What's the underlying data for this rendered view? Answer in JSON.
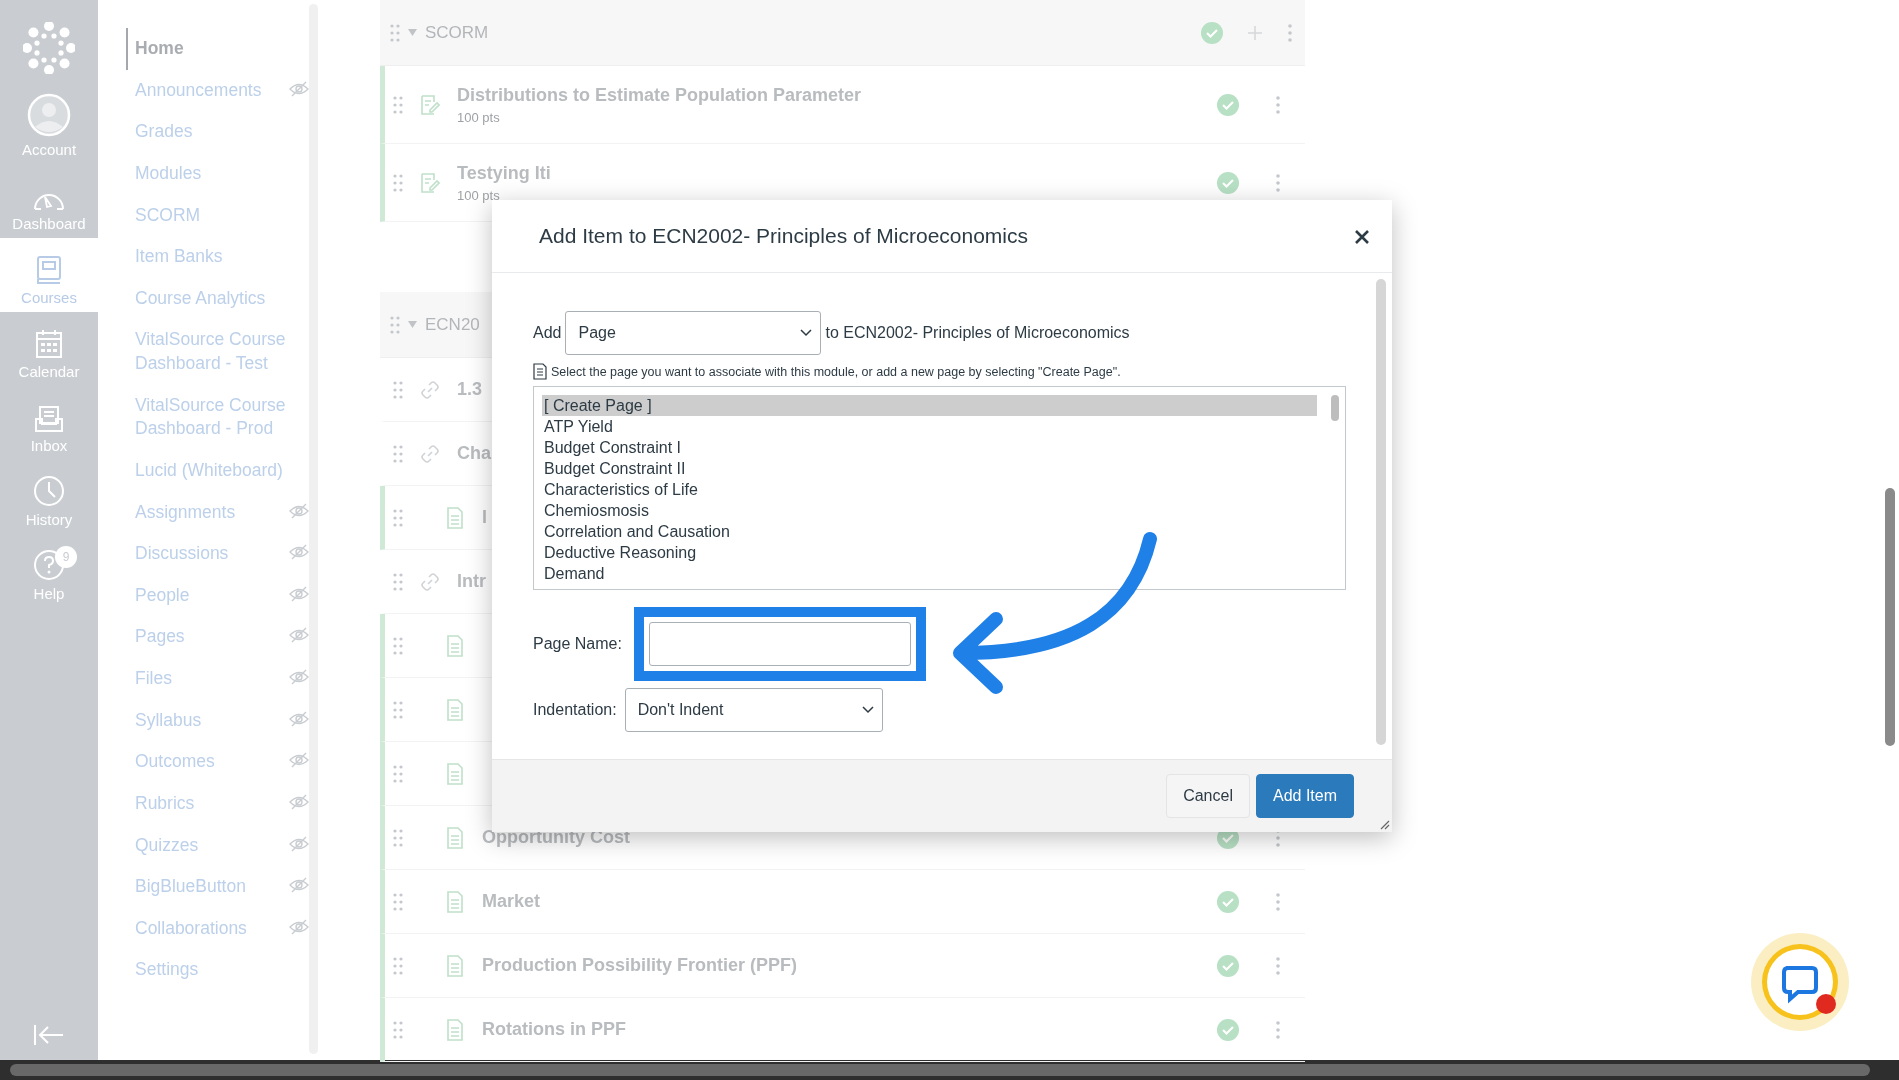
{
  "global_nav": {
    "items": [
      {
        "label": "Account",
        "kind": "account",
        "selected": false
      },
      {
        "label": "Dashboard",
        "kind": "dashboard",
        "selected": false
      },
      {
        "label": "Courses",
        "kind": "courses",
        "selected": true
      },
      {
        "label": "Calendar",
        "kind": "calendar",
        "selected": false
      },
      {
        "label": "Inbox",
        "kind": "inbox",
        "selected": false
      },
      {
        "label": "History",
        "kind": "history",
        "selected": false
      },
      {
        "label": "Help",
        "kind": "help",
        "selected": false,
        "badge": "9"
      }
    ]
  },
  "course_nav": {
    "items": [
      {
        "label": "Home",
        "selected": true,
        "hidden": false
      },
      {
        "label": "Announcements",
        "selected": false,
        "hidden": true
      },
      {
        "label": "Grades",
        "selected": false,
        "hidden": false
      },
      {
        "label": "Modules",
        "selected": false,
        "hidden": false
      },
      {
        "label": "SCORM",
        "selected": false,
        "hidden": false
      },
      {
        "label": "Item Banks",
        "selected": false,
        "hidden": false
      },
      {
        "label": "Course Analytics",
        "selected": false,
        "hidden": false
      },
      {
        "label": "VitalSource Course Dashboard - Test",
        "selected": false,
        "hidden": false
      },
      {
        "label": "VitalSource Course Dashboard - Prod",
        "selected": false,
        "hidden": false
      },
      {
        "label": "Lucid (Whiteboard)",
        "selected": false,
        "hidden": false
      },
      {
        "label": "Assignments",
        "selected": false,
        "hidden": true
      },
      {
        "label": "Discussions",
        "selected": false,
        "hidden": true
      },
      {
        "label": "People",
        "selected": false,
        "hidden": true
      },
      {
        "label": "Pages",
        "selected": false,
        "hidden": true
      },
      {
        "label": "Files",
        "selected": false,
        "hidden": true
      },
      {
        "label": "Syllabus",
        "selected": false,
        "hidden": true
      },
      {
        "label": "Outcomes",
        "selected": false,
        "hidden": true
      },
      {
        "label": "Rubrics",
        "selected": false,
        "hidden": true
      },
      {
        "label": "Quizzes",
        "selected": false,
        "hidden": true
      },
      {
        "label": "BigBlueButton",
        "selected": false,
        "hidden": true
      },
      {
        "label": "Collaborations",
        "selected": false,
        "hidden": true
      },
      {
        "label": "Settings",
        "selected": false,
        "hidden": false
      }
    ]
  },
  "modules": [
    {
      "title": "SCORM",
      "published": true,
      "items": [
        {
          "title": "Distributions to Estimate Population Parameter",
          "points": "100 pts",
          "kind": "assignment",
          "published": true
        },
        {
          "title": "Testying Iti",
          "points": "100 pts",
          "kind": "assignment",
          "published": true
        }
      ]
    },
    {
      "title": "ECN20",
      "items": [
        {
          "title": "1.3",
          "kind": "link"
        },
        {
          "title": "Cha",
          "kind": "link"
        },
        {
          "title": "I",
          "kind": "page"
        },
        {
          "title": "Intr",
          "kind": "link"
        },
        {
          "kind": "page"
        },
        {
          "kind": "page"
        },
        {
          "kind": "page"
        },
        {
          "title": "Opportunity Cost",
          "kind": "page",
          "published": true
        },
        {
          "title": "Market",
          "kind": "page",
          "published": true
        },
        {
          "title": "Production Possibility Frontier (PPF)",
          "kind": "page",
          "published": true
        },
        {
          "title": "Rotations in PPF",
          "kind": "page",
          "published": true
        }
      ]
    }
  ],
  "dialog": {
    "title": "Add Item to ECN2002- Principles of Microeconomics",
    "add_label": "Add",
    "type_select": "Page",
    "target": "to ECN2002- Principles of Microeconomics",
    "hint": "Select the page you want to associate with this module, or add a new page by selecting \"Create Page\".",
    "options": [
      {
        "label": "[ Create Page ]",
        "selected": true
      },
      {
        "label": "ATP Yield",
        "selected": false
      },
      {
        "label": "Budget Constraint I",
        "selected": false
      },
      {
        "label": "Budget Constraint II",
        "selected": false
      },
      {
        "label": "Characteristics of Life",
        "selected": false
      },
      {
        "label": "Chemiosmosis",
        "selected": false
      },
      {
        "label": "Correlation and Causation",
        "selected": false
      },
      {
        "label": "Deductive Reasoning",
        "selected": false
      },
      {
        "label": "Demand",
        "selected": false
      }
    ],
    "page_name_label": "Page Name:",
    "indentation_label": "Indentation:",
    "indentation_select": "Don't Indent",
    "buttons": [
      {
        "label": "Cancel",
        "kind": "secondary"
      },
      {
        "label": "Add Item",
        "kind": "primary"
      }
    ]
  }
}
